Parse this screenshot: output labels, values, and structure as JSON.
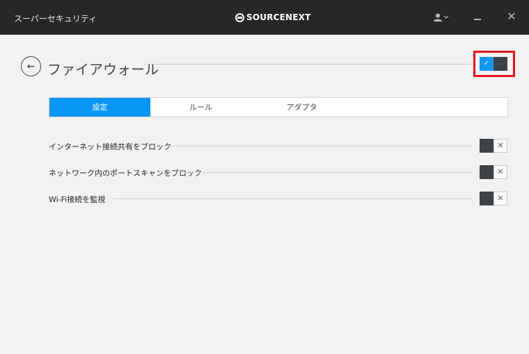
{
  "window": {
    "title": "スーパーセキュリティ",
    "brand": "SOURCENEXT",
    "user_icon": "user-icon",
    "minimize_icon": "minimize-icon",
    "close_glyph": "✕"
  },
  "header": {
    "title": "ファイアウォール",
    "back_glyph": "←",
    "master_toggle": {
      "state": "on",
      "check_glyph": "✓"
    }
  },
  "tabs": [
    {
      "label": "設定",
      "active": true
    },
    {
      "label": "ルール",
      "active": false
    },
    {
      "label": "アダプタ",
      "active": false
    }
  ],
  "settings": [
    {
      "label": "インターネット接続共有をブロック",
      "state": "off",
      "off_glyph": "✕"
    },
    {
      "label": "ネットワーク内のポートスキャンをブロック",
      "state": "off",
      "off_glyph": "✕"
    },
    {
      "label": "Wi-Fi接続を監視",
      "state": "off",
      "off_glyph": "✕"
    }
  ],
  "colors": {
    "titlebar": "#262729",
    "accent": "#0a96f5",
    "toggle_dark": "#3d4247",
    "highlight": "#e8141b"
  }
}
